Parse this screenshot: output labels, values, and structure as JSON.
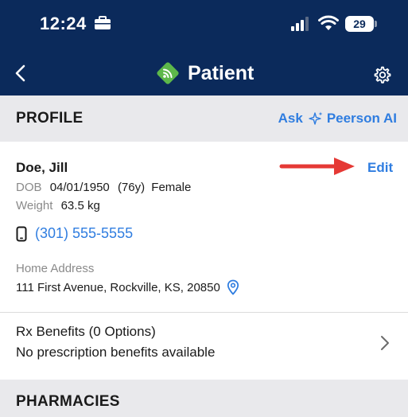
{
  "status_bar": {
    "time": "12:24",
    "battery": "29"
  },
  "nav": {
    "title": "Patient"
  },
  "profile_section": {
    "title": "PROFILE",
    "ask_label": "Ask",
    "ai_label": "Peerson AI"
  },
  "patient": {
    "name": "Doe, Jill",
    "edit_label": "Edit",
    "dob_label": "DOB",
    "dob": "04/01/1950",
    "age": "(76y)",
    "sex": "Female",
    "weight_label": "Weight",
    "weight": "63.5 kg",
    "phone": "(301) 555-5555",
    "home_address_label": "Home Address",
    "address": "111 First Avenue, Rockville, KS, 20850"
  },
  "rx_benefits": {
    "title": "Rx Benefits (0 Options)",
    "subtitle": "No prescription benefits available"
  },
  "pharmacies_section": {
    "title": "PHARMACIES"
  },
  "colors": {
    "header_bg": "#0b2a5b",
    "accent_blue": "#2f7de0",
    "logo_green": "#5db84a",
    "section_bg": "#e9e9ec",
    "annotation_arrow": "#e53935"
  }
}
